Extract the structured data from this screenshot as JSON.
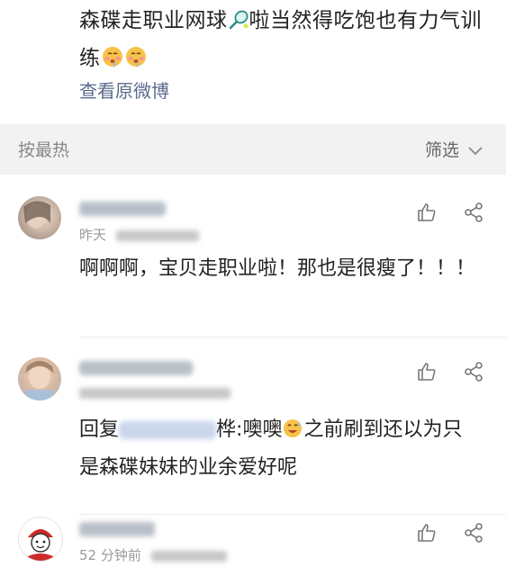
{
  "post": {
    "text_main": "森碟走职业网球",
    "text_after_emoji": "啦当然得吃饱也有力气训练",
    "emoji_racket": "tennis-racket-icon",
    "emoji_faces": "drooling-face-icon",
    "view_original": "查看原微博"
  },
  "sort_bar": {
    "label": "按最热",
    "filter_label": "筛选"
  },
  "comments": [
    {
      "time_fragment": "昨天",
      "text": "啊啊啊，宝贝走职业啦！那也是很瘦了！！！"
    },
    {
      "reply_prefix": "回复",
      "mention_tail": "桦",
      "reply_body_1": ":噢噢",
      "reply_body_2": "之前刷到还以为只是森碟妹妹的业余爱好呢"
    },
    {
      "time": "52 分钟前"
    }
  ],
  "colors": {
    "link": "#5b6b8c",
    "muted": "#9a9a9a",
    "icon": "#777777"
  }
}
